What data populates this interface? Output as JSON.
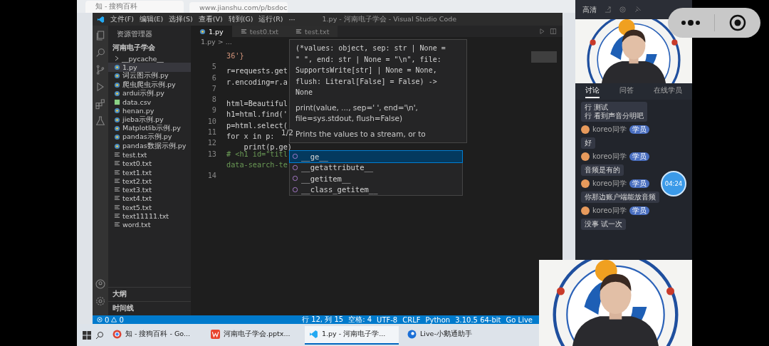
{
  "browser_tabs": [
    {
      "title": "知 - 搜狗百科"
    },
    {
      "title": "www.jianshu.com/p/bsdoc"
    }
  ],
  "vscode": {
    "title": "1.py - 河南电子学会 - Visual Studio Code",
    "menu": [
      "文件(F)",
      "编辑(E)",
      "选择(S)",
      "查看(V)",
      "转到(G)",
      "运行(R)",
      "···"
    ],
    "explorer": {
      "title": "资源管理器",
      "folder": "河南电子学会",
      "files": [
        {
          "name": "__pycache__",
          "kind": "folder",
          "selected": false
        },
        {
          "name": "1.py",
          "kind": "py",
          "selected": true
        },
        {
          "name": "词云图示例.py",
          "kind": "py",
          "selected": false
        },
        {
          "name": "爬虫爬虫示例.py",
          "kind": "py",
          "selected": false
        },
        {
          "name": "ardui示例.py",
          "kind": "py",
          "selected": false
        },
        {
          "name": "data.csv",
          "kind": "csv",
          "selected": false
        },
        {
          "name": "henan.py",
          "kind": "py",
          "selected": false
        },
        {
          "name": "jieba示例.py",
          "kind": "py",
          "selected": false
        },
        {
          "name": "Matplotlib示例.py",
          "kind": "py",
          "selected": false
        },
        {
          "name": "pandas示例.py",
          "kind": "py",
          "selected": false
        },
        {
          "name": "pandas数据示例.py",
          "kind": "py",
          "selected": false
        },
        {
          "name": "test.txt",
          "kind": "txt",
          "selected": false
        },
        {
          "name": "text0.txt",
          "kind": "txt",
          "selected": false
        },
        {
          "name": "text1.txt",
          "kind": "txt",
          "selected": false
        },
        {
          "name": "text2.txt",
          "kind": "txt",
          "selected": false
        },
        {
          "name": "text3.txt",
          "kind": "txt",
          "selected": false
        },
        {
          "name": "text4.txt",
          "kind": "txt",
          "selected": false
        },
        {
          "name": "text5.txt",
          "kind": "txt",
          "selected": false
        },
        {
          "name": "text11111.txt",
          "kind": "txt",
          "selected": false
        },
        {
          "name": "word.txt",
          "kind": "txt",
          "selected": false
        }
      ],
      "sections": [
        "大纲",
        "时间线"
      ]
    },
    "tabs": [
      {
        "label": "1.py",
        "kind": "py",
        "selected": true
      },
      {
        "label": "test0.txt",
        "kind": "txt",
        "selected": false
      },
      {
        "label": "test.txt",
        "kind": "txt",
        "selected": false
      }
    ],
    "breadcrumb": "1.py > ...",
    "code_lines": [
      {
        "text": "36'}",
        "kind": "string"
      },
      {
        "number": "5",
        "text": "r=requests.get",
        "kind": "code"
      },
      {
        "number": "6",
        "text": "r.encoding=r.a",
        "kind": "code"
      },
      {
        "number": "7",
        "kind": "code"
      },
      {
        "number": "8",
        "text": "html=Beautiful",
        "kind": "code"
      },
      {
        "number": "9",
        "text": "h1=html.find('",
        "kind": "code"
      },
      {
        "number": "10",
        "text": "p=html.select(",
        "kind": "code"
      },
      {
        "number": "11",
        "text": "for x in p:",
        "kind": "code"
      },
      {
        "number": "12",
        "text": "    print(p.ge)",
        "kind": "code"
      },
      {
        "number": "13",
        "text": "# <h1 id=\"titl",
        "kind": "comment"
      },
      {
        "text": "data-search-te",
        "kind": "comment"
      },
      {
        "number": "14",
        "kind": "code"
      }
    ],
    "hover": {
      "signature": [
        "(*values: object, sep: str | None =",
        "\" \", end: str | None = \"\\n\", file:",
        "SupportsWrite[str] | None = None,",
        "flush: Literal[False] = False) ->",
        "None"
      ],
      "doc_signature": "print(value, ..., sep=' ', end='\\n', file=sys.stdout, flush=False)",
      "counter": "1/2",
      "doc": "Prints the values to a stream, or to"
    },
    "suggestions": [
      {
        "label": "__ge__",
        "selected": true
      },
      {
        "label": "__getattribute__",
        "selected": false
      },
      {
        "label": "__getitem__",
        "selected": false
      },
      {
        "label": "__class_getitem__",
        "selected": false
      }
    ],
    "status_bar": {
      "errors": "0",
      "warnings": "0",
      "items": [
        "行 12, 列 15",
        "空格: 4",
        "UTF-8",
        "CRLF",
        "Python",
        "3.10.5 64-bit",
        "Go Live"
      ]
    }
  },
  "taskbar": {
    "apps": [
      {
        "label": "知 - 搜狗百科 - Go...",
        "kind": "browser",
        "active": false
      },
      {
        "label": "河南电子学会.pptx...",
        "kind": "slides",
        "active": false
      },
      {
        "label": "1.py - 河南电子学...",
        "kind": "editor",
        "active": true
      },
      {
        "label": "Live-小鹅通助手",
        "kind": "live",
        "active": false
      }
    ]
  },
  "chat": {
    "quality": "高清",
    "tabs": [
      {
        "label": "讨论",
        "selected": true
      },
      {
        "label": "问答",
        "selected": false
      },
      {
        "label": "在线学员",
        "selected": false
      }
    ],
    "messages": [
      {
        "kind": "notice",
        "lines": [
          "行 测试",
          "行 看到声音分明吧"
        ]
      },
      {
        "kind": "user",
        "name": "koreo同学",
        "badge": "学员",
        "text": "好"
      },
      {
        "kind": "user",
        "name": "koreo同学",
        "badge": "学员",
        "text": "音频是有的"
      },
      {
        "kind": "user",
        "name": "koreo同学",
        "badge": "学员",
        "text": "你那边账户端能放音频"
      },
      {
        "kind": "user",
        "name": "koreo同学",
        "badge": "学员",
        "text": "没事 试一次"
      }
    ]
  },
  "timer": "04:24"
}
